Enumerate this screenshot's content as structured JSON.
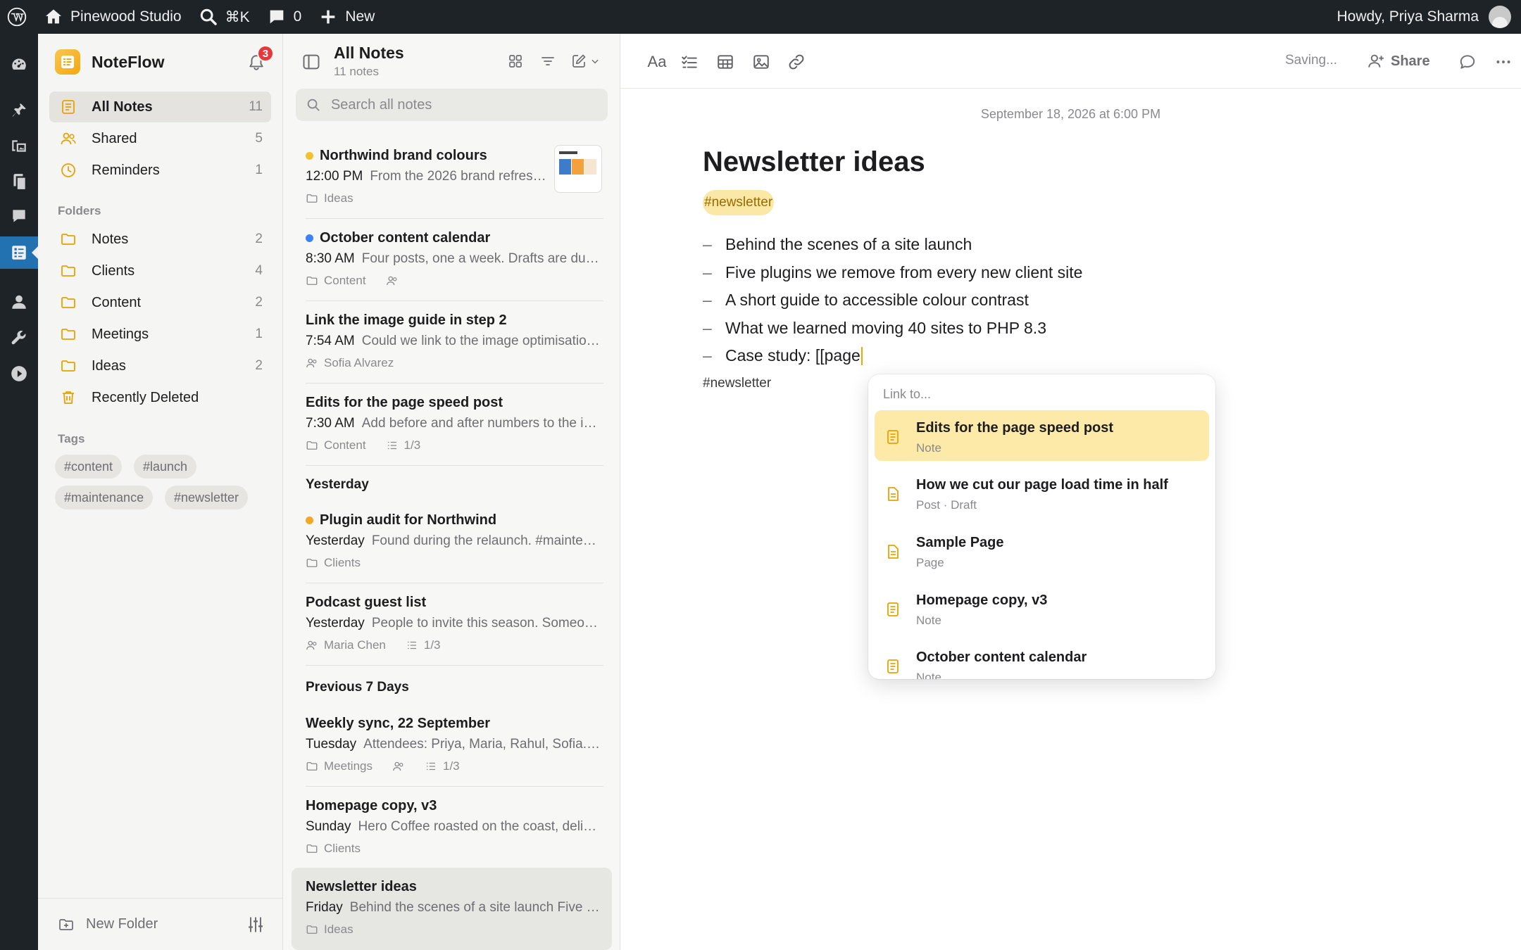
{
  "adminbar": {
    "site_name": "Pinewood Studio",
    "search_shortcut": "⌘K",
    "comments_count": "0",
    "new_label": "New",
    "greeting": "Howdy, Priya Sharma"
  },
  "app": {
    "name": "NoteFlow",
    "notification_count": "3"
  },
  "sidebar": {
    "library": [
      {
        "label": "All Notes",
        "count": "11"
      },
      {
        "label": "Shared",
        "count": "5"
      },
      {
        "label": "Reminders",
        "count": "1"
      }
    ],
    "folders_heading": "Folders",
    "folders": [
      {
        "label": "Notes",
        "count": "2"
      },
      {
        "label": "Clients",
        "count": "4"
      },
      {
        "label": "Content",
        "count": "2"
      },
      {
        "label": "Meetings",
        "count": "1"
      },
      {
        "label": "Ideas",
        "count": "2"
      }
    ],
    "recently_deleted": "Recently Deleted",
    "tags_heading": "Tags",
    "tags": [
      "#content",
      "#launch",
      "#maintenance",
      "#newsletter"
    ],
    "new_folder": "New Folder"
  },
  "notelist": {
    "title": "All Notes",
    "subtitle": "11 notes",
    "search_placeholder": "Search all notes",
    "groups": {
      "yesterday": "Yesterday",
      "previous": "Previous 7 Days"
    },
    "notes": [
      {
        "title": "Northwind brand colours",
        "time": "12:00 PM",
        "preview": "From the 2026 brand refresh. Primary blue, orange accent…",
        "folder": "Ideas",
        "dot": "#f2c12e"
      },
      {
        "title": "October content calendar",
        "time": "8:30 AM",
        "preview": "Four posts, one a week. Drafts are due the Friday before…",
        "folder": "Content",
        "dot": "#3b82f6"
      },
      {
        "title": "Link the image guide in step 2",
        "time": "7:54 AM",
        "preview": "Could we link to the image optimisation guide here?",
        "person": "Sofia Alvarez"
      },
      {
        "title": "Edits for the page speed post",
        "time": "7:30 AM",
        "preview": "Add before and after numbers to the intro paragraph…",
        "folder": "Content",
        "checklist": "1/3"
      },
      {
        "title": "Plugin audit for Northwind",
        "time": "Yesterday",
        "preview": "Found during the relaunch. #maintenance review pending…",
        "folder": "Clients",
        "dot": "#f5a623"
      },
      {
        "title": "Podcast guest list",
        "time": "Yesterday",
        "preview": "People to invite this season. Someone from the agency…",
        "person": "Maria Chen",
        "checklist": "1/3"
      },
      {
        "title": "Weekly sync, 22 September",
        "time": "Tuesday",
        "preview": "Attendees: Priya, Maria, Rahul, Sofia. Agenda items…",
        "folder": "Meetings",
        "checklist": "1/3"
      },
      {
        "title": "Homepage copy, v3",
        "time": "Sunday",
        "preview": "Hero Coffee roasted on the coast, delivered fresh…",
        "folder": "Clients"
      },
      {
        "title": "Newsletter ideas",
        "time": "Friday",
        "preview": "Behind the scenes of a site launch Five plugins we…",
        "folder": "Ideas"
      }
    ]
  },
  "editor": {
    "status": "Saving...",
    "share_label": "Share",
    "format_label": "Aa",
    "date": "September 18, 2026 at 6:00 PM",
    "title": "Newsletter ideas",
    "tag": "#newsletter",
    "items": [
      "Behind the scenes of a site launch",
      "Five plugins we remove from every new client site",
      "A short guide to accessible colour contrast",
      "What we learned moving 40 sites to PHP 8.3",
      "Case study: [[page"
    ],
    "footer_tag": "#newsletter"
  },
  "link_popover": {
    "heading": "Link to...",
    "items": [
      {
        "title": "Edits for the page speed post",
        "type": "Note"
      },
      {
        "title": "How we cut our page load time in half",
        "type": "Post · Draft"
      },
      {
        "title": "Sample Page",
        "type": "Page"
      },
      {
        "title": "Homepage copy, v3",
        "type": "Note"
      },
      {
        "title": "October content calendar",
        "type": "Note"
      }
    ]
  },
  "colors": {
    "accent": "#f0a500",
    "wp_admin_bar": "#1d2327",
    "wp_active": "#2271b1",
    "highlight": "#fde9a8"
  }
}
